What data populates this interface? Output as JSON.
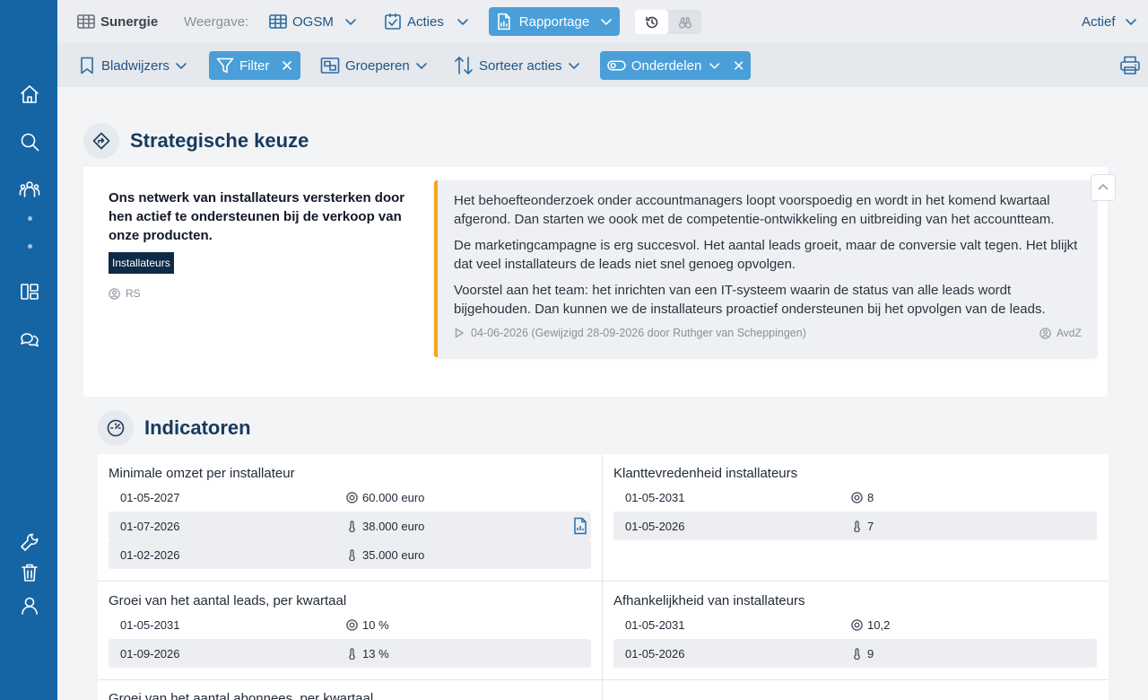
{
  "topbar": {
    "app_name": "Sunergie",
    "view_label": "Weergave:",
    "view_value": "OGSM",
    "acties_label": "Acties",
    "rapportage_label": "Rapportage",
    "status_label": "Actief"
  },
  "toolbar": {
    "bookmarks_label": "Bladwijzers",
    "filter_label": "Filter",
    "group_label": "Groeperen",
    "sort_label": "Sorteer acties",
    "parts_label": "Onderdelen"
  },
  "strategy": {
    "section_title": "Strategische keuze",
    "choice_text": "Ons netwerk van installateurs versterken door hen actief te ondersteunen bij de verkoop van onze producten.",
    "tag": "Installateurs",
    "owner": "RS",
    "note": {
      "paragraphs": [
        "Het behoefteonderzoek onder accountmanagers loopt voorspoedig en wordt in het komend kwartaal afgerond. Dan starten we oook met de competentie-ontwikkeling en uitbreiding van het accountteam.",
        "De marketingcampagne is erg succesvol. Het aantal leads groeit, maar de conversie valt tegen. Het blijkt dat veel installateurs de leads niet snel genoeg opvolgen.",
        "Voorstel aan het team: het inrichten van een IT-systeem waarin de status van alle leads wordt bijgehouden. Dan kunnen we de installateurs proactief ondersteunen bij het opvolgen van de leads."
      ],
      "meta": "04-06-2026 (Gewijzigd 28-09-2026 door Ruthger van Scheppingen)",
      "author": "AvdZ"
    }
  },
  "indicators": {
    "section_title": "Indicatoren",
    "items": [
      {
        "title": "Minimale omzet per installateur",
        "rows": [
          {
            "date": "01-05-2027",
            "value": "60.000 euro",
            "kind": "target"
          },
          {
            "date": "01-07-2026",
            "value": "38.000 euro",
            "kind": "measure"
          },
          {
            "date": "01-02-2026",
            "value": "35.000 euro",
            "kind": "measure"
          }
        ]
      },
      {
        "title": "Klanttevredenheid installateurs",
        "rows": [
          {
            "date": "01-05-2031",
            "value": "8",
            "kind": "target"
          },
          {
            "date": "01-05-2026",
            "value": "7",
            "kind": "measure"
          }
        ]
      },
      {
        "title": "Groei van het aantal leads, per kwartaal",
        "rows": [
          {
            "date": "01-05-2031",
            "value": "10 %",
            "kind": "target"
          },
          {
            "date": "01-09-2026",
            "value": "13 %",
            "kind": "measure"
          }
        ]
      },
      {
        "title": "Afhankelijkheid van installateurs",
        "rows": [
          {
            "date": "01-05-2031",
            "value": "10,2",
            "kind": "target"
          },
          {
            "date": "01-05-2026",
            "value": "9",
            "kind": "measure"
          }
        ]
      },
      {
        "title": "Groei van het aantal abonnees, per kwartaal",
        "rows": []
      }
    ]
  }
}
